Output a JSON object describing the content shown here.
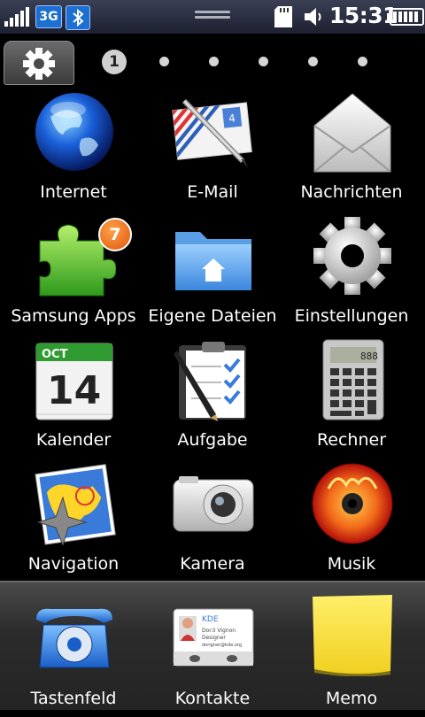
{
  "status_bar": {
    "network_type": "3G",
    "time": "15:31"
  },
  "pager": {
    "current_page": "1",
    "total_dots": 6
  },
  "apps": [
    {
      "label": "Internet",
      "icon": "globe-icon"
    },
    {
      "label": "E-Mail",
      "icon": "email-icon"
    },
    {
      "label": "Nachrichten",
      "icon": "envelope-icon"
    },
    {
      "label": "Samsung Apps",
      "icon": "puzzle-icon",
      "badge": "7"
    },
    {
      "label": "Eigene Dateien",
      "icon": "folder-home-icon"
    },
    {
      "label": "Einstellungen",
      "icon": "gear-icon"
    },
    {
      "label": "Kalender",
      "icon": "calendar-icon",
      "month": "OCT",
      "day": "14"
    },
    {
      "label": "Aufgabe",
      "icon": "task-list-icon"
    },
    {
      "label": "Rechner",
      "icon": "calculator-icon",
      "display": "888"
    },
    {
      "label": "Navigation",
      "icon": "map-compass-icon"
    },
    {
      "label": "Kamera",
      "icon": "camera-icon"
    },
    {
      "label": "Musik",
      "icon": "music-disc-icon"
    }
  ],
  "dock": [
    {
      "label": "Tastenfeld",
      "icon": "phone-icon"
    },
    {
      "label": "Kontakte",
      "icon": "contact-card-icon",
      "card_org": "KDE",
      "card_name": "Dor.li Vignon",
      "card_title": "Designer",
      "card_email": "dorigner@kde.org"
    },
    {
      "label": "Memo",
      "icon": "memo-note-icon"
    }
  ]
}
